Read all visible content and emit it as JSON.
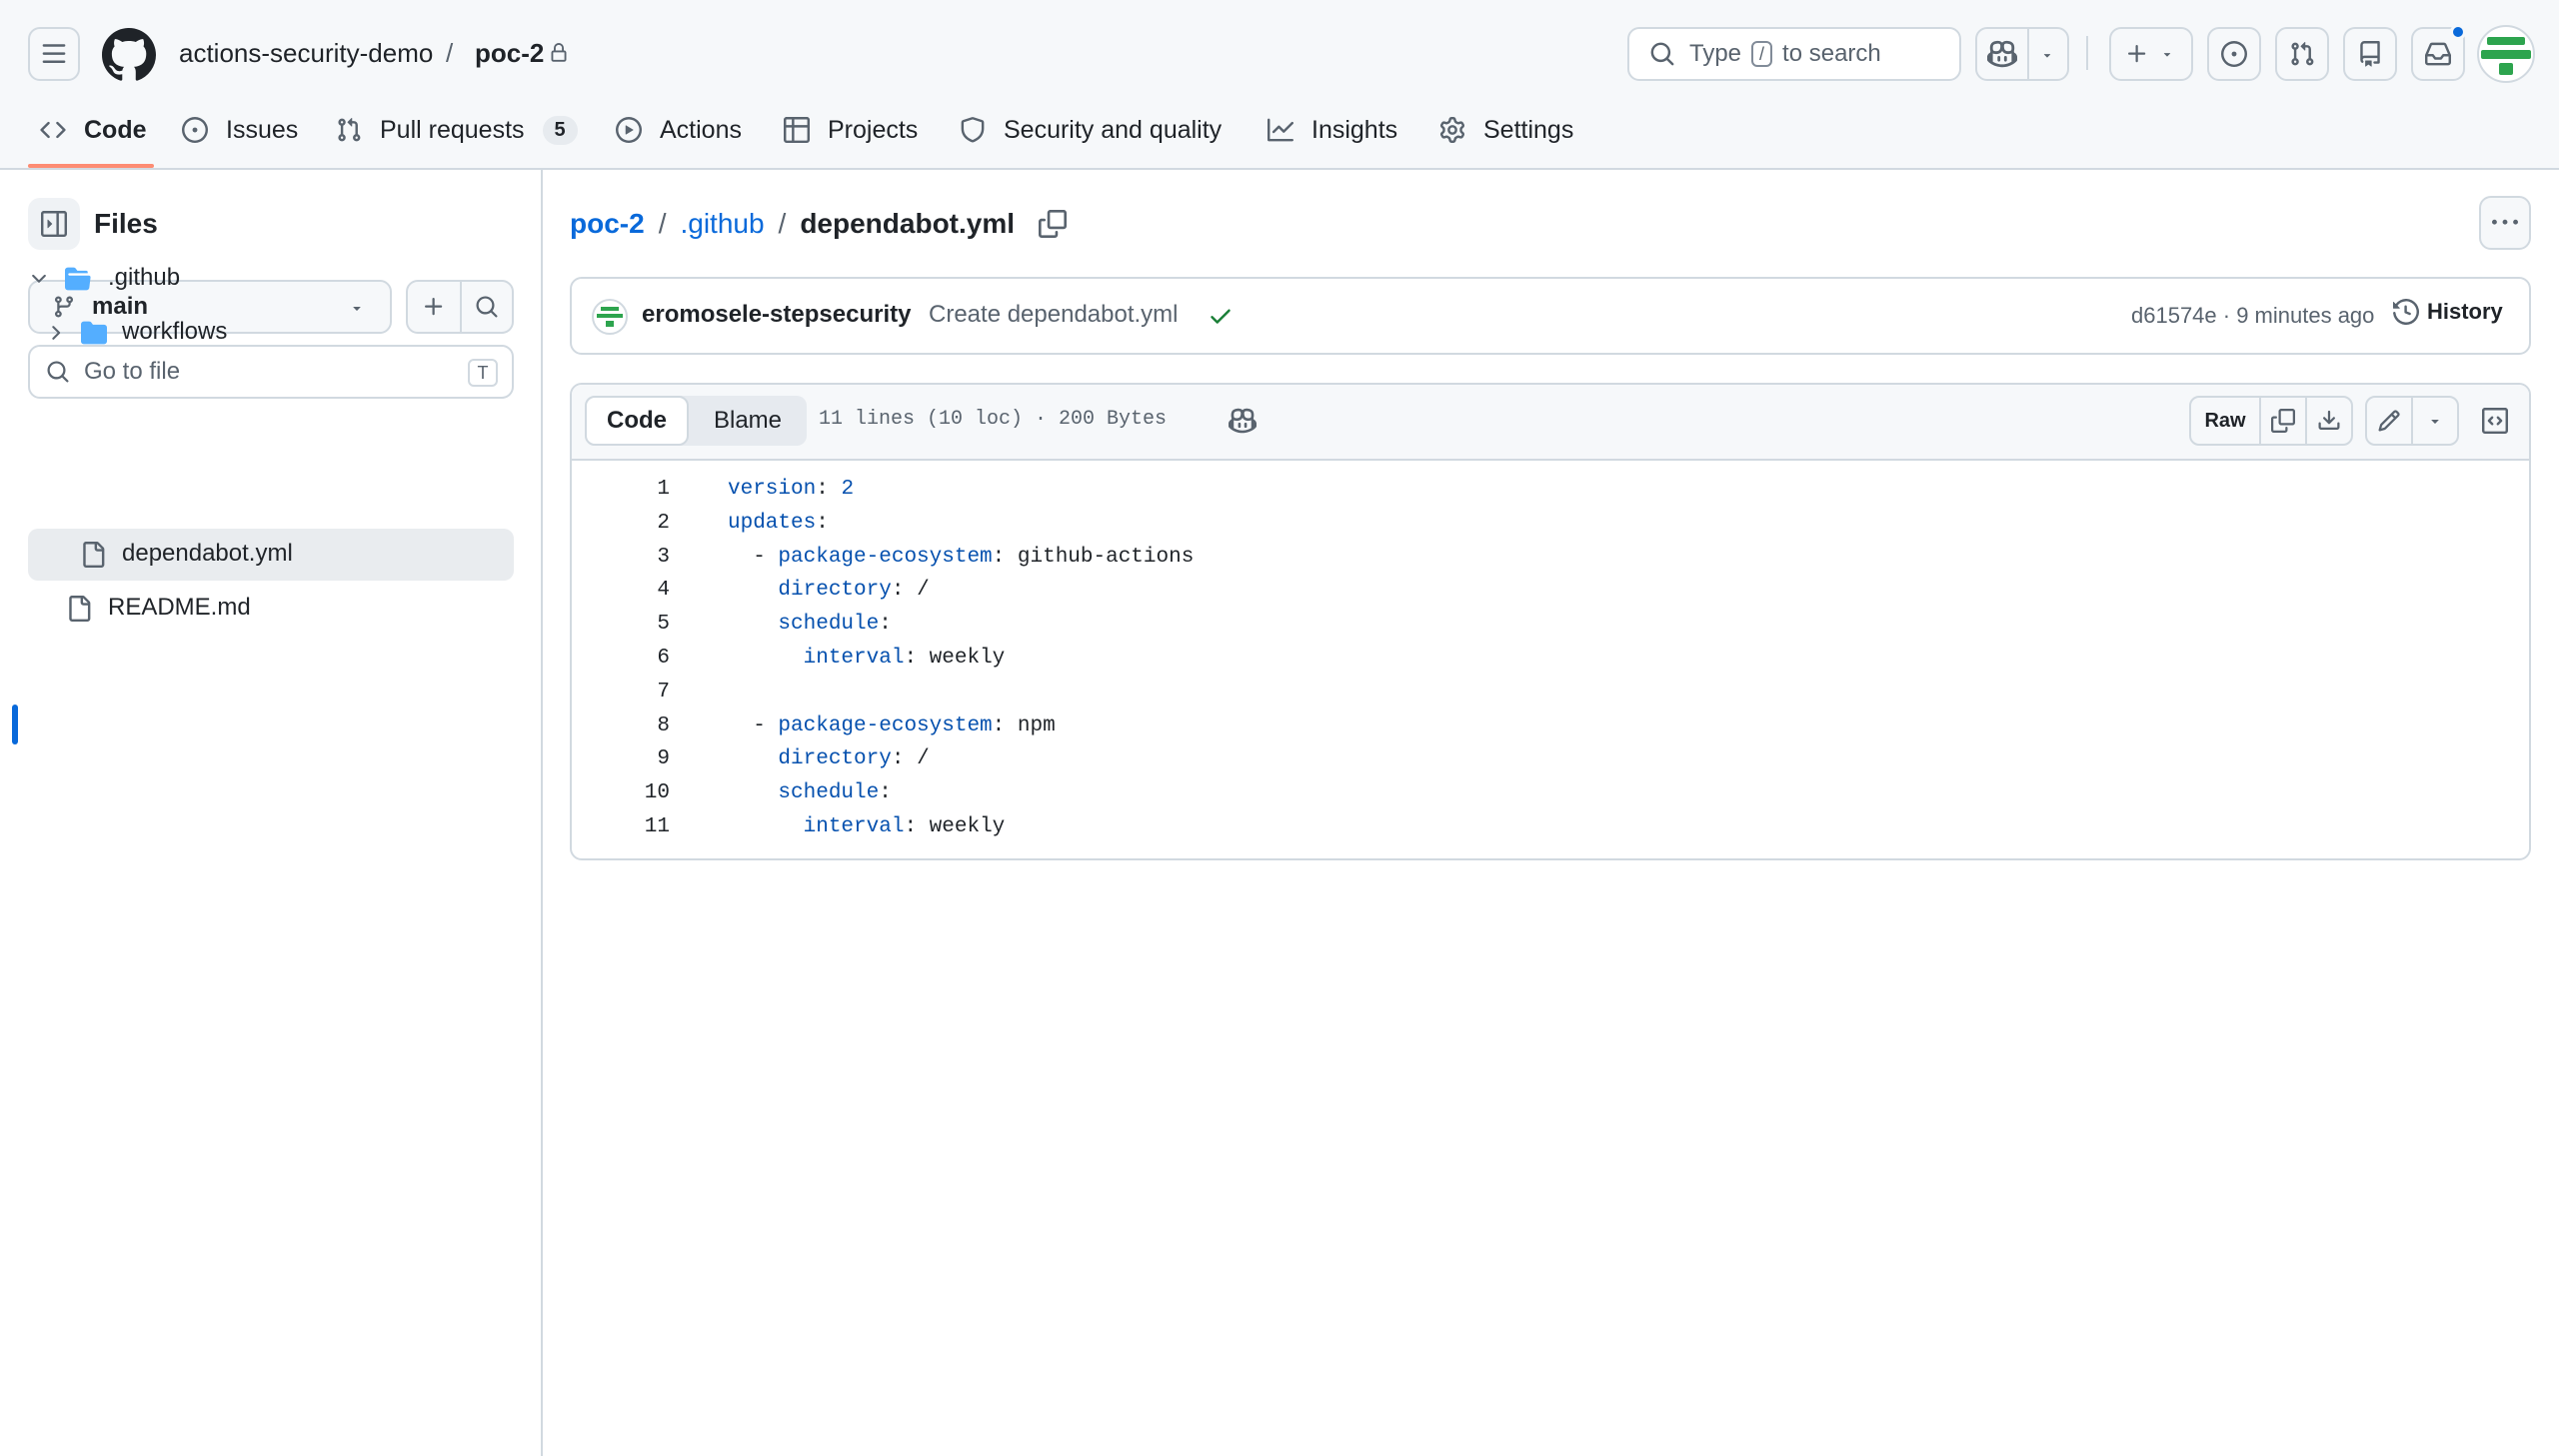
{
  "header": {
    "owner": "actions-security-demo",
    "separator": "/",
    "repo": "poc-2",
    "search_prefix": "Type",
    "search_key": "/",
    "search_suffix": "to search"
  },
  "nav": {
    "tabs": [
      {
        "label": "Code",
        "icon": "code-icon",
        "active": true
      },
      {
        "label": "Issues",
        "icon": "issue-icon"
      },
      {
        "label": "Pull requests",
        "icon": "pull-request-icon",
        "count": "5"
      },
      {
        "label": "Actions",
        "icon": "play-icon"
      },
      {
        "label": "Projects",
        "icon": "table-icon"
      },
      {
        "label": "Security and quality",
        "icon": "shield-icon"
      },
      {
        "label": "Insights",
        "icon": "graph-icon"
      },
      {
        "label": "Settings",
        "icon": "gear-icon"
      }
    ]
  },
  "sidebar": {
    "title": "Files",
    "branch": "main",
    "goto_placeholder": "Go to file",
    "goto_shortcut": "T",
    "tree": [
      {
        "name": ".github",
        "type": "folder",
        "expanded": true
      },
      {
        "name": "workflows",
        "type": "folder",
        "expanded": false
      },
      {
        "name": "dependabot.yml",
        "type": "file",
        "selected": true
      },
      {
        "name": "README.md",
        "type": "file"
      }
    ]
  },
  "breadcrumb": {
    "repo": "poc-2",
    "sep": "/",
    "folder": ".github",
    "file": "dependabot.yml"
  },
  "commit": {
    "author": "eromosele-stepsecurity",
    "message": "Create dependabot.yml",
    "sha_time": "d61574e · 9 minutes ago",
    "history_label": "History"
  },
  "file_toolbar": {
    "code_tab": "Code",
    "blame_tab": "Blame",
    "info": "11 lines (10 loc) · 200 Bytes",
    "raw_label": "Raw"
  },
  "code_lines": [
    {
      "n": "1",
      "indent": "",
      "key": "version",
      "colon": ": ",
      "value": "2",
      "num": true
    },
    {
      "n": "2",
      "indent": "",
      "key": "updates",
      "colon": ":",
      "value": ""
    },
    {
      "n": "3",
      "indent": "  - ",
      "key": "package-ecosystem",
      "colon": ": ",
      "value": "github-actions"
    },
    {
      "n": "4",
      "indent": "    ",
      "key": "directory",
      "colon": ": ",
      "value": "/"
    },
    {
      "n": "5",
      "indent": "    ",
      "key": "schedule",
      "colon": ":",
      "value": ""
    },
    {
      "n": "6",
      "indent": "      ",
      "key": "interval",
      "colon": ": ",
      "value": "weekly"
    },
    {
      "n": "7",
      "indent": "",
      "key": "",
      "colon": "",
      "value": ""
    },
    {
      "n": "8",
      "indent": "  - ",
      "key": "package-ecosystem",
      "colon": ": ",
      "value": "npm"
    },
    {
      "n": "9",
      "indent": "    ",
      "key": "directory",
      "colon": ": ",
      "value": "/"
    },
    {
      "n": "10",
      "indent": "    ",
      "key": "schedule",
      "colon": ":",
      "value": ""
    },
    {
      "n": "11",
      "indent": "      ",
      "key": "interval",
      "colon": ": ",
      "value": "weekly"
    }
  ],
  "colors": {
    "link": "#0969da",
    "accent_underline": "#fd8c73",
    "yaml_key": "#0550ae",
    "success": "#1a7f37",
    "folder": "#54aeff",
    "selected_bar": "#0969da",
    "notification_dot": "#0969da"
  }
}
